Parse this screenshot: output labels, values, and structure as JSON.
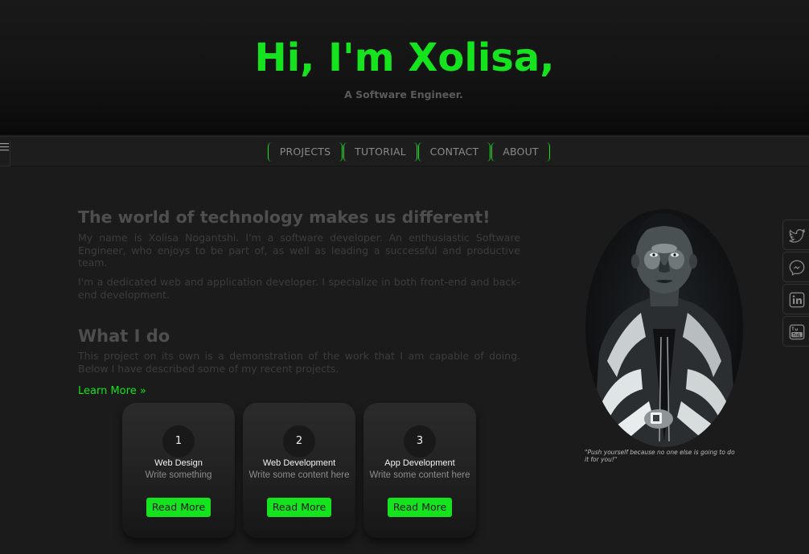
{
  "header": {
    "title": "Hi, I'm Xolisa,",
    "subtitle": "A Software Engineer."
  },
  "nav": {
    "menu_icon": "hamburger-icon",
    "items": [
      {
        "label": "PROJECTS"
      },
      {
        "label": "TUTORIAL"
      },
      {
        "label": "CONTACT"
      },
      {
        "label": "ABOUT"
      }
    ]
  },
  "intro": {
    "heading": "The world of technology makes us different!",
    "paragraph_1": "My name is Xolisa Nogantshi. I'm a software developer. An enthusiastic Software Engineer, who enjoys to be part of, as well as leading a successful and productive team.",
    "paragraph_2": "I'm a dedicated web and application developer. I specialize in both front-end and back-end development."
  },
  "what_i_do": {
    "heading": "What I do",
    "paragraph": "This project on its own is a demonstration of the work that I am capable of doing. Below I have described some of my recent projects.",
    "link": "Learn More »"
  },
  "cards": [
    {
      "number": "1",
      "title": "Web Design",
      "text": "Write something",
      "button": "Read More"
    },
    {
      "number": "2",
      "title": "Web Development",
      "text": "Write some content here",
      "button": "Read More"
    },
    {
      "number": "3",
      "title": "App Development",
      "text": "Write some content here",
      "button": "Read More"
    }
  ],
  "portrait": {
    "quote": "\"Push yourself because no one else is going to do it for you!\""
  },
  "social": [
    {
      "icon": "twitter-icon"
    },
    {
      "icon": "messenger-icon"
    },
    {
      "icon": "linkedin-icon"
    },
    {
      "icon": "youtube-icon"
    }
  ],
  "colors": {
    "accent": "#14e31e",
    "background": "#1b1b1b",
    "header": "#111111"
  }
}
